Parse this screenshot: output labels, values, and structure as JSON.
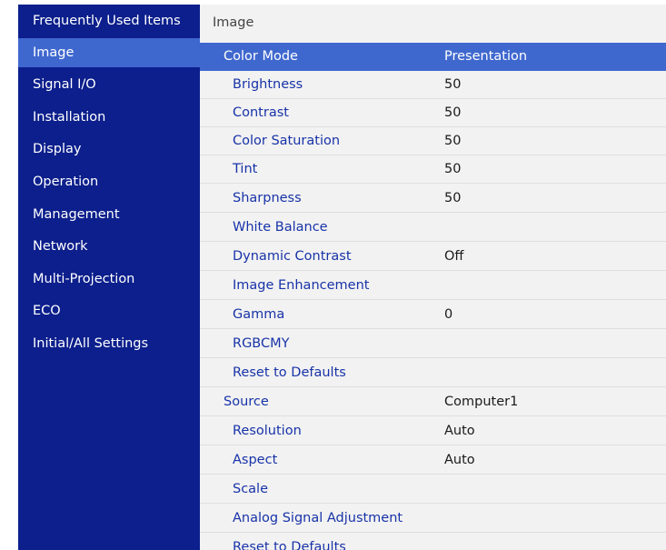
{
  "sidebar": {
    "items": [
      {
        "label": "Frequently Used Items"
      },
      {
        "label": "Image"
      },
      {
        "label": "Signal I/O"
      },
      {
        "label": "Installation"
      },
      {
        "label": "Display"
      },
      {
        "label": "Operation"
      },
      {
        "label": "Management"
      },
      {
        "label": "Network"
      },
      {
        "label": "Multi-Projection"
      },
      {
        "label": "ECO"
      },
      {
        "label": "Initial/All Settings"
      }
    ],
    "selected_index": 1
  },
  "content": {
    "title": "Image",
    "rows": [
      {
        "label": "Color Mode",
        "value": "Presentation"
      },
      {
        "label": "Brightness",
        "value": "50"
      },
      {
        "label": "Contrast",
        "value": "50"
      },
      {
        "label": "Color Saturation",
        "value": "50"
      },
      {
        "label": "Tint",
        "value": "50"
      },
      {
        "label": "Sharpness",
        "value": "50"
      },
      {
        "label": "White Balance",
        "value": ""
      },
      {
        "label": "Dynamic Contrast",
        "value": "Off"
      },
      {
        "label": "Image Enhancement",
        "value": ""
      },
      {
        "label": "Gamma",
        "value": "0"
      },
      {
        "label": "RGBCMY",
        "value": ""
      },
      {
        "label": "Reset to Defaults",
        "value": ""
      },
      {
        "label": "Source",
        "value": "Computer1"
      },
      {
        "label": "Resolution",
        "value": "Auto"
      },
      {
        "label": "Aspect",
        "value": "Auto"
      },
      {
        "label": "Scale",
        "value": ""
      },
      {
        "label": "Analog Signal Adjustment",
        "value": ""
      },
      {
        "label": "Reset to Defaults",
        "value": ""
      }
    ],
    "selected_index": 0
  },
  "colors": {
    "sidebar_bg": "#0c1f8c",
    "selection": "#3f68cf",
    "content_bg": "#f2f2f2",
    "label_text": "#1833a8"
  }
}
